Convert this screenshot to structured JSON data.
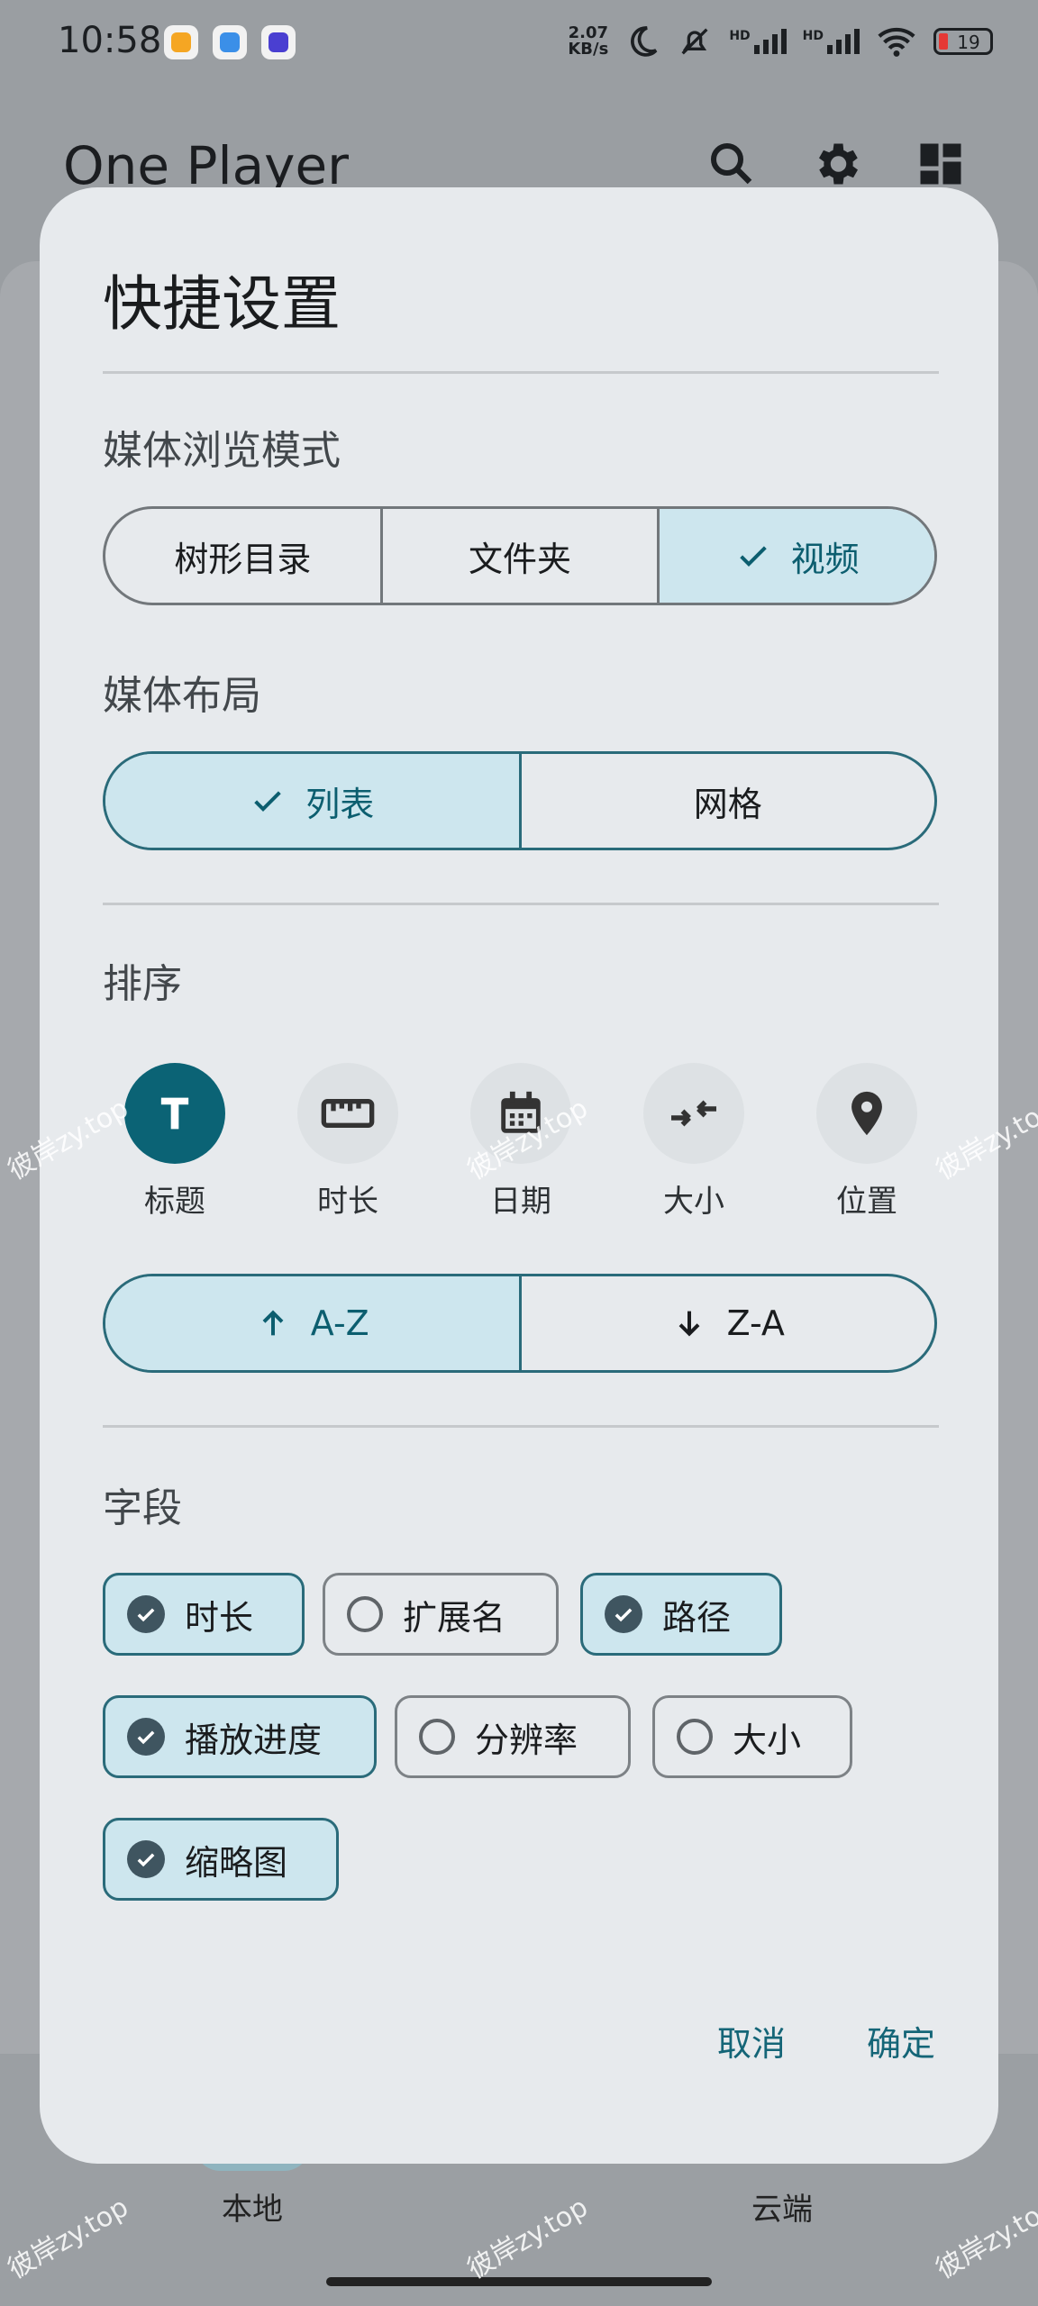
{
  "status_bar": {
    "time": "10:58",
    "net_speed_top": "2.07",
    "net_speed_bottom": "KB/s",
    "hd1": "HD",
    "hd2": "HD",
    "battery": "19"
  },
  "app": {
    "title": "One Player",
    "nav": [
      {
        "label": "本地"
      },
      {
        "label": "云端"
      }
    ]
  },
  "dialog": {
    "title": "快捷设置",
    "browse_mode": {
      "label": "媒体浏览模式",
      "options": [
        {
          "label": "树形目录",
          "selected": false
        },
        {
          "label": "文件夹",
          "selected": false
        },
        {
          "label": "视频",
          "selected": true
        }
      ]
    },
    "layout": {
      "label": "媒体布局",
      "options": [
        {
          "label": "列表",
          "selected": true
        },
        {
          "label": "网格",
          "selected": false
        }
      ]
    },
    "sort": {
      "label": "排序",
      "keys": [
        {
          "label": "标题",
          "icon": "title-T-icon",
          "selected": true
        },
        {
          "label": "时长",
          "icon": "ruler-icon",
          "selected": false
        },
        {
          "label": "日期",
          "icon": "calendar-icon",
          "selected": false
        },
        {
          "label": "大小",
          "icon": "compress-arrows-icon",
          "selected": false
        },
        {
          "label": "位置",
          "icon": "location-pin-icon",
          "selected": false
        }
      ],
      "order": [
        {
          "label": "A-Z",
          "selected": true
        },
        {
          "label": "Z-A",
          "selected": false
        }
      ]
    },
    "fields": {
      "label": "字段",
      "chips": [
        {
          "label": "时长",
          "checked": true
        },
        {
          "label": "扩展名",
          "checked": false
        },
        {
          "label": "路径",
          "checked": true
        },
        {
          "label": "播放进度",
          "checked": true
        },
        {
          "label": "分辨率",
          "checked": false
        },
        {
          "label": "大小",
          "checked": false
        },
        {
          "label": "缩略图",
          "checked": true
        }
      ]
    },
    "cancel": "取消",
    "confirm": "确定"
  },
  "watermark": "彼岸zy.top",
  "colors": {
    "accent": "#0b6375",
    "selected_fill": "#cde6ee",
    "dialog_bg": "#e7eaed",
    "scrim": "#9a9ea2"
  }
}
